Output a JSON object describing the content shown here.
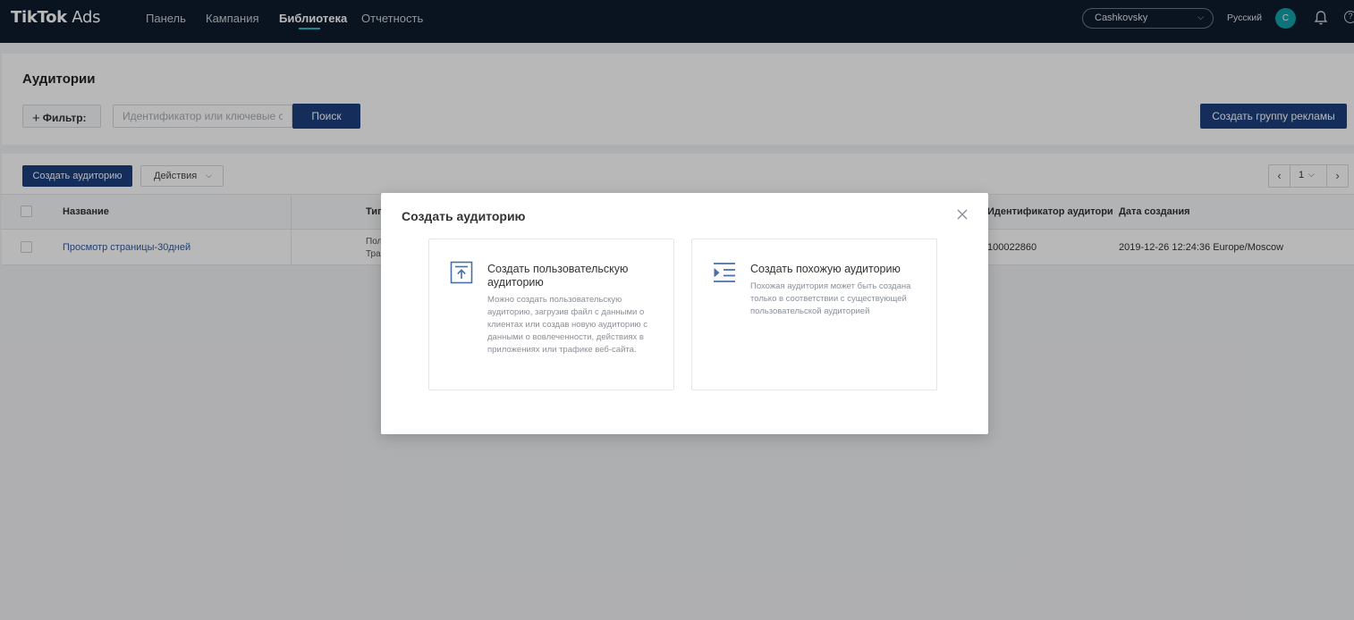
{
  "topnav": {
    "logo_bold": "TikTok",
    "logo_light": " Ads",
    "items": [
      {
        "label": "Панель"
      },
      {
        "label": "Кампания"
      },
      {
        "label": "Библиотека"
      },
      {
        "label": "Отчетность"
      }
    ],
    "active_item": "Библиотека",
    "account": "Cashkovsky",
    "language": "Русский",
    "avatar_letter": "C",
    "help_glyph": "?"
  },
  "page": {
    "title": "Аудитории",
    "filter_label": "Фильтр:",
    "search_placeholder": "Идентификатор или ключевые сл",
    "search_button": "Поиск",
    "create_group_button": "Создать группу рекламы"
  },
  "table": {
    "create_button": "Создать аудиторию",
    "actions_button": "Действия",
    "current_page": "1",
    "columns": {
      "name": "Название",
      "type": "Тип",
      "audience_id": "Идентификатор аудитори",
      "created": "Дата создания"
    },
    "rows": [
      {
        "name": "Просмотр страницы-30дней",
        "type_line1": "Пол",
        "type_line2": "Тра",
        "audience_id": "100022860",
        "created": "2019-12-26 12:24:36 Europe/Moscow"
      }
    ]
  },
  "modal": {
    "title": "Создать аудиторию",
    "cards": [
      {
        "icon": "upload-icon",
        "title": "Создать пользовательскую аудиторию",
        "description": "Можно создать пользовательскую аудиторию, загрузив файл с данными о клиентах или создав новую аудиторию с данными о вовлеченности, действиях в приложениях или трафике веб-сайта."
      },
      {
        "icon": "indent-list-icon",
        "title": "Создать похожую аудиторию",
        "description": "Похожая аудитория может быть создана только в соответствии с существующей пользовательской аудиторией"
      }
    ]
  },
  "colors": {
    "nav_bg": "#0e1c2e",
    "accent_teal": "#25c2c9",
    "primary_button": "#1d3f7e",
    "link": "#2a5cad"
  }
}
